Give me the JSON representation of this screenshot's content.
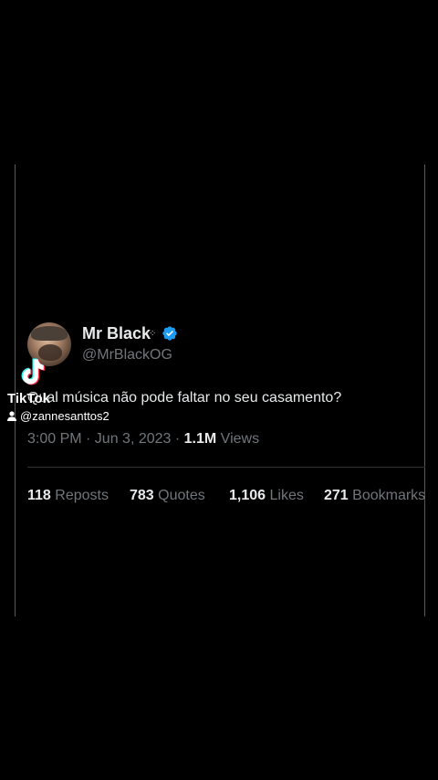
{
  "tweet": {
    "display_name": "Mr Black",
    "name_decoration": "⁘",
    "handle": "@MrBlackOG",
    "text": "Qual música não pode faltar no seu casamento?",
    "time": "3:00 PM · Jun 3, 2023 · ",
    "views_count": "1.1M",
    "views_label": " Views",
    "stats": [
      {
        "count": "118",
        "label": " Reposts"
      },
      {
        "count": "783",
        "label": " Quotes"
      },
      {
        "count": "1,106",
        "label": " Likes"
      },
      {
        "count": "271",
        "label": " Bookmarks"
      }
    ]
  },
  "watermark": {
    "brand": "TikTok",
    "username": "@zannesanttos2"
  },
  "colors": {
    "background": "#000000",
    "text_primary": "#e7e9ea",
    "text_secondary": "#71767b",
    "verified": "#1d9bf0",
    "divider": "#2f3336"
  },
  "icons": [
    "verified-badge-icon",
    "tiktok-logo-icon",
    "user-icon"
  ]
}
